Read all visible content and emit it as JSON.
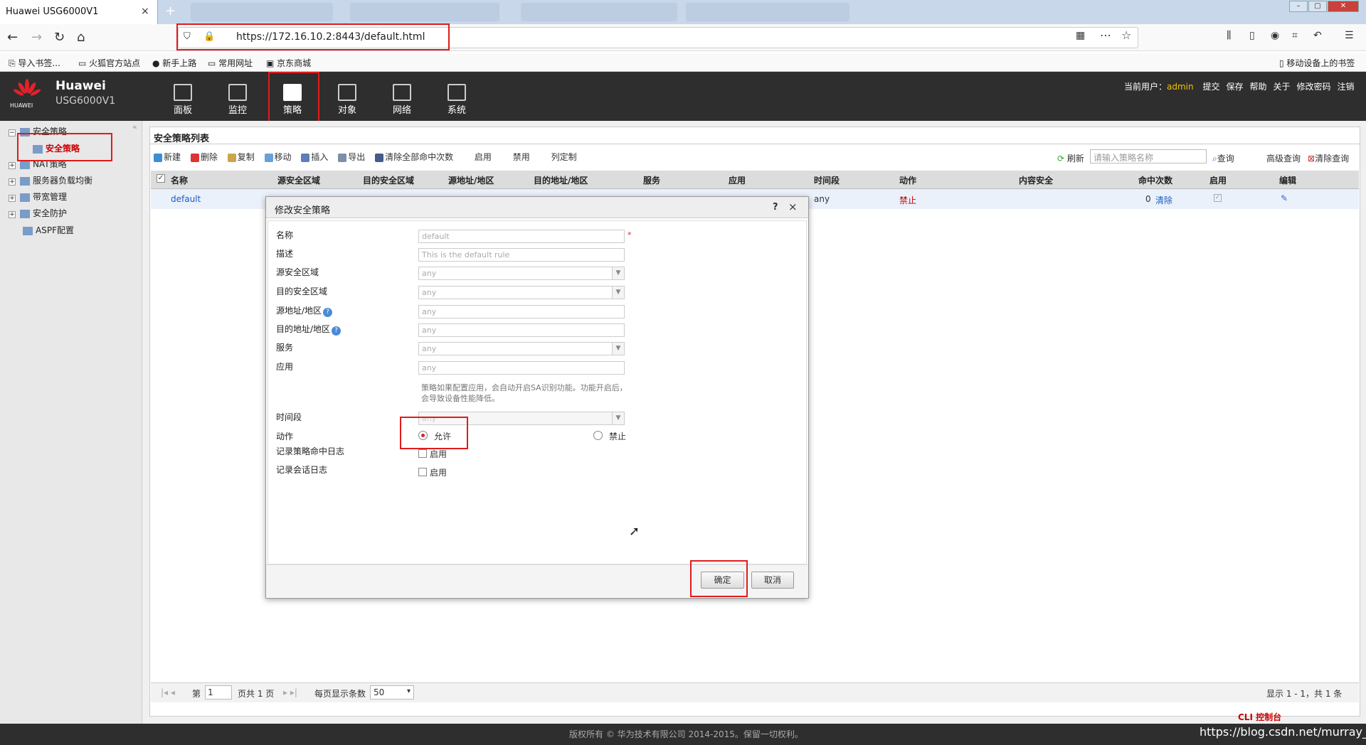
{
  "browser": {
    "active_tab_title": "Huawei USG6000V1",
    "new_tab_icon": "+",
    "url": "https://172.16.10.2:8443/default.html",
    "close_glyph": "×"
  },
  "bookmarks": [
    "导入书签...",
    "火狐官方站点",
    "新手上路",
    "常用网址",
    "京东商城",
    "移动设备上的书签"
  ],
  "app": {
    "brand": "Huawei",
    "model": "USG6000V1",
    "logo_text": "HUAWEI",
    "nav": [
      "面板",
      "监控",
      "策略",
      "对象",
      "网络",
      "系统"
    ],
    "user_label": "当前用户：",
    "user": "admin",
    "user_links": [
      "提交",
      "保存",
      "帮助",
      "关于",
      "修改密码",
      "注销"
    ]
  },
  "sidebar": {
    "items": [
      {
        "label": "安全策略",
        "pm": "−"
      },
      {
        "label": "安全策略",
        "selected": true
      },
      {
        "label": "NAT策略",
        "pm": "+"
      },
      {
        "label": "服务器负载均衡",
        "pm": "+"
      },
      {
        "label": "带宽管理",
        "pm": "+"
      },
      {
        "label": "安全防护",
        "pm": "+"
      },
      {
        "label": "ASPF配置"
      }
    ]
  },
  "list": {
    "title": "安全策略列表",
    "toolbar": [
      "新建",
      "删除",
      "复制",
      "移动",
      "插入",
      "导出",
      "清除全部命中次数",
      "启用",
      "禁用",
      "列定制"
    ],
    "right_toolbar": {
      "refresh": "刷新",
      "search_placeholder": "请输入策略名称",
      "query": "查询",
      "advanced": "高级查询",
      "clear": "清除查询"
    },
    "columns": [
      "名称",
      "源安全区域",
      "目的安全区域",
      "源地址/地区",
      "目的地址/地区",
      "服务",
      "应用",
      "时间段",
      "动作",
      "内容安全",
      "命中次数",
      "启用",
      "编辑"
    ],
    "row": {
      "name": "default",
      "time": "any",
      "action": "禁止",
      "hits": "0",
      "clear": "清除"
    },
    "pager": {
      "page_label": "第",
      "page": "1",
      "of": "页共 1 页",
      "per_page_label": "每页显示条数",
      "per_page": "50",
      "summary": "显示 1 - 1，共 1 条"
    }
  },
  "dialog": {
    "title": "修改安全策略",
    "help": "?",
    "close": "×",
    "fields": {
      "name_label": "名称",
      "name_value": "default",
      "required_mark": "*",
      "desc_label": "描述",
      "desc_value": "This is the default rule",
      "src_zone_label": "源安全区域",
      "src_zone": "any",
      "dst_zone_label": "目的安全区域",
      "dst_zone": "any",
      "src_addr_label": "源地址/地区",
      "src_addr": "any",
      "dst_addr_label": "目的地址/地区",
      "dst_addr": "any",
      "service_label": "服务",
      "service": "any",
      "app_label": "应用",
      "app": "any",
      "hint": "策略如果配置应用，会自动开启SA识别功能。功能开启后，会导致设备性能降低。",
      "time_label": "时间段",
      "time": "any",
      "action_label": "动作",
      "permit": "允许",
      "deny": "禁止",
      "log_hit_label": "记录策略命中日志",
      "log_hit_opt": "启用",
      "log_sess_label": "记录会话日志",
      "log_sess_opt": "启用"
    },
    "ok": "确定",
    "cancel": "取消"
  },
  "footer": {
    "copyright": "版权所有 © 华为技术有限公司 2014-2015。保留一切权利。",
    "cli": "CLI 控制台",
    "watermark": "https://blog.csdn.net/murray_fan"
  }
}
